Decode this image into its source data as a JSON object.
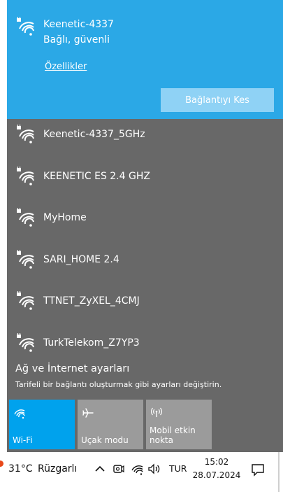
{
  "connected_network": {
    "ssid": "Keenetic-4337",
    "status": "Bağlı, güvenli",
    "properties_link": "Özellikler",
    "disconnect_button": "Bağlantıyı Kes"
  },
  "networks": [
    {
      "ssid": "Keenetic-4337_5GHz"
    },
    {
      "ssid": "KEENETIC ES 2.4 GHZ"
    },
    {
      "ssid": "MyHome"
    },
    {
      "ssid": "SARI_HOME 2.4"
    },
    {
      "ssid": "TTNET_ZyXEL_4CMJ"
    },
    {
      "ssid": "TurkTelekom_Z7YP3"
    }
  ],
  "settings": {
    "title": "Ağ ve İnternet ayarları",
    "description": "Tarifeli bir bağlantı oluşturmak gibi ayarları değiştirin."
  },
  "quick_actions": {
    "wifi": {
      "label": "Wi-Fi",
      "icon": "wifi-icon",
      "active": true
    },
    "airplane": {
      "label": "Uçak modu",
      "icon": "airplane-icon",
      "active": false
    },
    "mobile_hotspot": {
      "label": "Mobil etkin\nnokta",
      "icon": "hotspot-icon",
      "active": false
    }
  },
  "taskbar": {
    "temperature": "31°C",
    "weather": "Rüzgarlı",
    "language": "TUR",
    "time": "15:02",
    "date": "28.07.2024"
  },
  "colors": {
    "flyout_bg": "#686868",
    "connected_bg": "#2ba8e6",
    "disconnect_button_bg": "#8fd2f5",
    "active_tile": "#00a2ed",
    "inactive_tile": "#9b9b9b",
    "weather_dot": "#e8481a"
  }
}
